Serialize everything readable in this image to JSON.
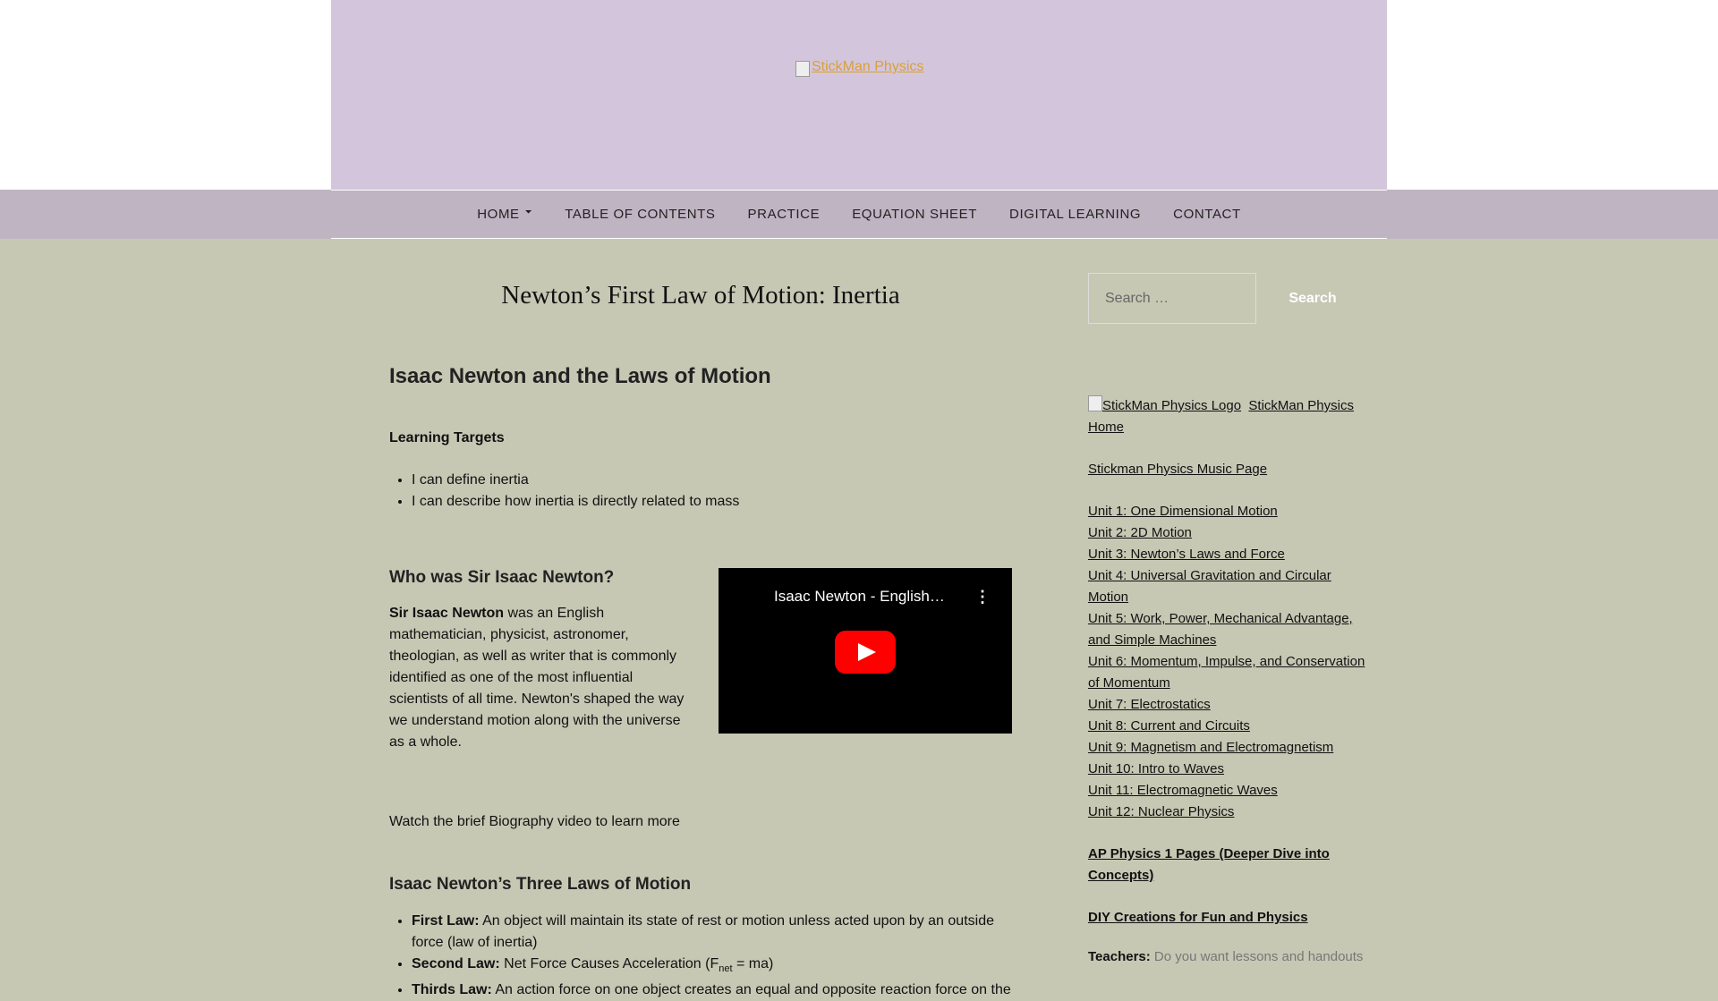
{
  "header": {
    "logo_alt": "StickMan Physics"
  },
  "nav": {
    "items": [
      {
        "label": "HOME",
        "has_submenu": true
      },
      {
        "label": "TABLE OF CONTENTS"
      },
      {
        "label": "PRACTICE"
      },
      {
        "label": "EQUATION SHEET"
      },
      {
        "label": "DIGITAL LEARNING"
      },
      {
        "label": "CONTACT"
      }
    ]
  },
  "main": {
    "title": "Newton’s First Law of Motion: Inertia",
    "section_heading": "Isaac Newton and the Laws of Motion",
    "learning_targets_label": "Learning Targets",
    "learning_targets": [
      "I can define inertia",
      "I can describe how inertia is directly related to mass"
    ],
    "who_heading": "Who was Sir Isaac Newton?",
    "who_bold": "Sir Isaac Newton",
    "who_text": " was an English mathematician, physicist, astronomer, theologian, as well as writer that is commonly identified as one of the most influential scientists of all time.  Newton's shaped the way we understand motion along with the universe as a whole.",
    "watch_text": "Watch the brief Biography video to learn more",
    "video": {
      "title": "Isaac Newton - English…",
      "menu_glyph": "⋮"
    },
    "laws_heading": "Isaac Newton’s Three Laws of Motion",
    "laws": [
      {
        "label": "First Law:",
        "text": " An object will maintain its state of rest or motion unless acted upon by an outside force (law of inertia)"
      },
      {
        "label": "Second Law:",
        "text_before": " Net Force Causes Acceleration (F",
        "sub": "net",
        "text_after": " = ma)"
      },
      {
        "label": "Thirds Law:",
        "text": " An action force on one object creates an equal and opposite reaction force on the"
      }
    ]
  },
  "sidebar": {
    "search_placeholder": "Search …",
    "search_button": "Search",
    "logo_alt": "StickMan Physics Logo",
    "home_link": "StickMan Physics Home",
    "music_link": "Stickman Physics Music Page",
    "units": [
      "Unit 1: One Dimensional Motion",
      "Unit 2: 2D Motion",
      "Unit 3: Newton’s Laws and Force",
      "Unit 4: Universal Gravitation and Circular Motion",
      "Unit 5: Work, Power, Mechanical Advantage, and Simple Machines",
      "Unit 6: Momentum, Impulse, and Conservation of Momentum",
      "Unit 7: Electrostatics",
      "Unit 8: Current and Circuits",
      "Unit 9: Magnetism and Electromagnetism",
      "Unit 10: Intro to Waves",
      "Unit 11: Electromagnetic Waves",
      "Unit 12: Nuclear Physics"
    ],
    "ap_link": "AP Physics 1 Pages (Deeper Dive into Concepts)",
    "diy_link": "DIY Creations for Fun and Physics",
    "teachers_label": "Teachers:",
    "teachers_text": " Do you want lessons and handouts"
  }
}
